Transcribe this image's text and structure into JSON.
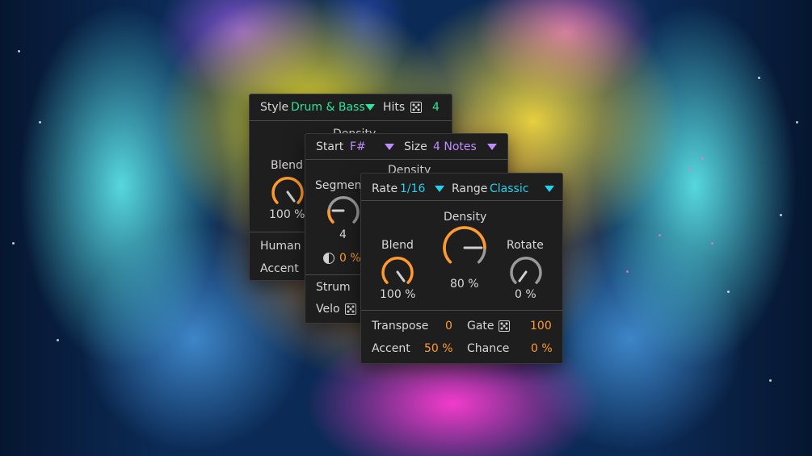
{
  "colors": {
    "panel_bg": "#1e1e1e",
    "accent_green": "#2ee59d",
    "accent_purple": "#c08cff",
    "accent_cyan": "#26d0ee",
    "accent_orange": "#ff9a2e",
    "knob_gray": "#9a9a9a"
  },
  "panel_back": {
    "style_label": "Style",
    "style_value": "Drum & Bass",
    "hits_label": "Hits",
    "hits_value": "4",
    "density_label": "Density",
    "blend_label": "Blend",
    "blend_value": "100 %",
    "human_label": "Human",
    "accent_label": "Accent"
  },
  "panel_mid": {
    "start_label": "Start",
    "start_value": "F#",
    "size_label": "Size",
    "size_value": "4 Notes",
    "density_label": "Density",
    "segments_label": "Segments",
    "segments_value": "4",
    "phase_value": "0 %",
    "strum_label": "Strum",
    "velo_label": "Velo"
  },
  "panel_front": {
    "rate_label": "Rate",
    "rate_value": "1/16",
    "range_label": "Range",
    "range_value": "Classic",
    "density_label": "Density",
    "density_value": "80 %",
    "density_level": 0.8,
    "blend_label": "Blend",
    "blend_value": "100 %",
    "blend_level": 1.0,
    "rotate_label": "Rotate",
    "rotate_value": "0 %",
    "rotate_level": 0.0,
    "transpose_label": "Transpose",
    "transpose_value": "0",
    "gate_label": "Gate",
    "gate_value": "100",
    "accent_label": "Accent",
    "accent_value": "50 %",
    "chance_label": "Chance",
    "chance_value": "0 %"
  }
}
